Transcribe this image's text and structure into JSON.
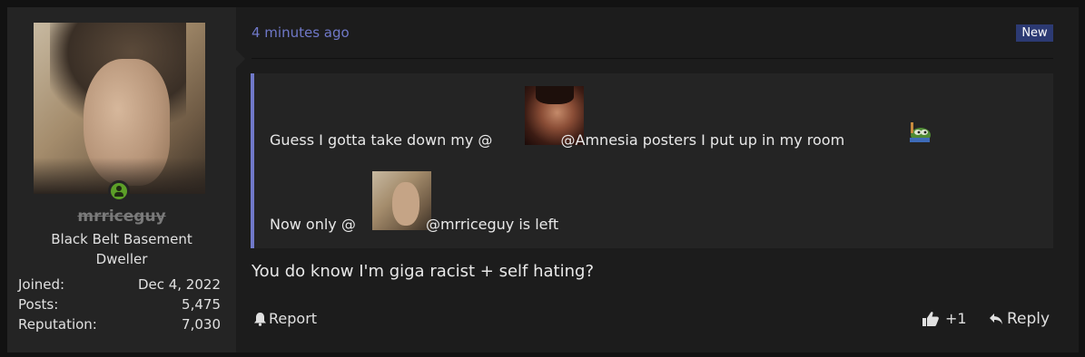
{
  "post": {
    "user": {
      "username": "mrriceguy",
      "title_line1": "Black Belt Basement",
      "title_line2": "Dweller",
      "stats": [
        {
          "label": "Joined:",
          "value": "Dec 4, 2022"
        },
        {
          "label": "Posts:",
          "value": "5,475"
        },
        {
          "label": "Reputation:",
          "value": "7,030"
        }
      ],
      "status_icon": "user-online-icon"
    },
    "time": "4 minutes ago",
    "badge": "New",
    "quote": {
      "line1_before": "Guess I gotta take down my @",
      "line1_after": " @Amnesia posters I put up in my room",
      "line2_before": "Now only @",
      "line2_after": " @mrriceguy is left"
    },
    "message": "You do know I'm giga racist + self hating?",
    "actions": {
      "report_label": "Report",
      "like_label": "+1",
      "reply_label": "Reply"
    },
    "colors": {
      "accent": "#7079c9",
      "online": "#5c9f28",
      "badge": "#2c3a73"
    }
  }
}
